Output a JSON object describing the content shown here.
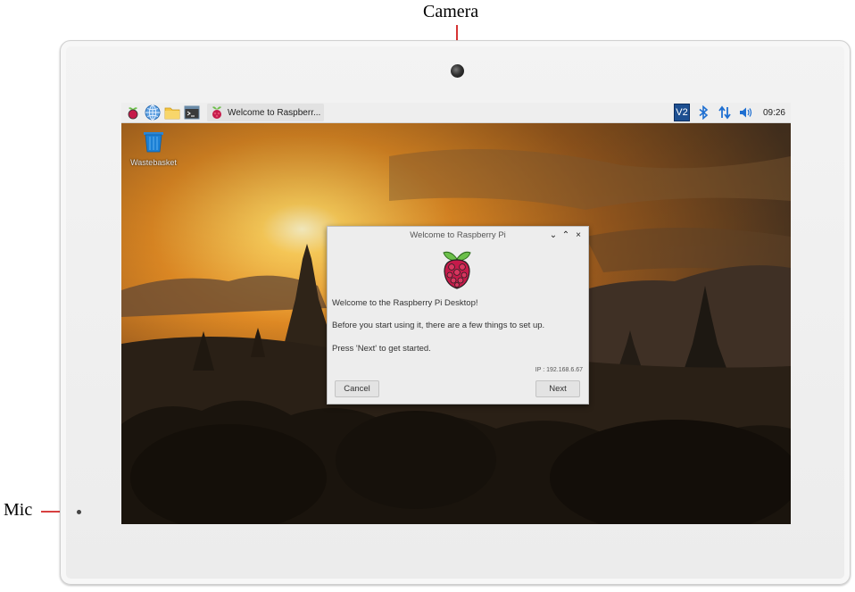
{
  "annotations": {
    "camera_label": "Camera",
    "mic_label": "Mic"
  },
  "taskbar": {
    "launchers": [
      {
        "icon": "raspberry-menu-icon"
      },
      {
        "icon": "web-browser-globe-icon"
      },
      {
        "icon": "file-manager-folder-icon"
      },
      {
        "icon": "terminal-icon"
      }
    ],
    "task": {
      "icon": "raspberry-icon",
      "label": "Welcome to Raspberr..."
    },
    "tray": {
      "vnc_icon_text": "V2",
      "clock": "09:26"
    }
  },
  "desktop": {
    "icons": [
      {
        "label": "Wastebasket",
        "icon": "wastebasket-icon"
      }
    ]
  },
  "dialog": {
    "title": "Welcome to Raspberry Pi",
    "controls": {
      "minimize": "⌄",
      "maximize": "⌃",
      "close": "×"
    },
    "line1": "Welcome to the Raspberry Pi Desktop!",
    "line2": "Before you start using it, there are a few things to set up.",
    "line3": "Press 'Next' to get started.",
    "ip": "IP : 192.168.6.67",
    "cancel_label": "Cancel",
    "next_label": "Next"
  },
  "colors": {
    "accent_vnc": "#1d4f91",
    "bluetooth": "#1e6fd1",
    "raspberry_red": "#c51a4a",
    "leaf_green": "#6cc04a"
  }
}
